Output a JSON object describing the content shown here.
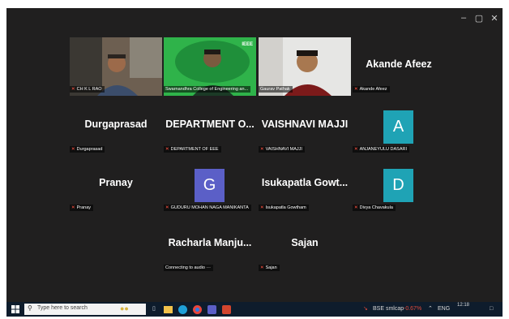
{
  "window_controls": {
    "minimize": "–",
    "maximize": "▢",
    "close": "✕"
  },
  "participants": [
    {
      "id": "chkl",
      "name": "",
      "label": "CH K L RAO",
      "type": "video"
    },
    {
      "id": "swarnandhra",
      "name": "",
      "label": "Swarnandhra College of Engineering an...",
      "type": "video",
      "brand": "IEEE"
    },
    {
      "id": "gaurav",
      "name": "",
      "label": "Gaurav Pathak",
      "type": "video"
    },
    {
      "id": "akande",
      "name": "Akande Afeez",
      "label": "Akande Afeez",
      "type": "name"
    },
    {
      "id": "durgaprasad",
      "name": "Durgaprasad",
      "label": "Durgaprasad",
      "type": "name"
    },
    {
      "id": "dept",
      "name": "DEPARTMENT O...",
      "label": "DEPARTMENT OF EEE",
      "type": "name"
    },
    {
      "id": "vaishnavi",
      "name": "VAISHNAVI MAJJI",
      "label": "VAISHNAVI MAJJI",
      "type": "name"
    },
    {
      "id": "anjaneyulu",
      "avatar": "A",
      "label": "ANJANEYULU DASARI",
      "type": "avatar",
      "color": "#1fa3b5"
    },
    {
      "id": "pranay",
      "name": "Pranay",
      "label": "Pranay",
      "type": "name"
    },
    {
      "id": "guduru",
      "avatar": "G",
      "label": "GUDURU MOHAN NAGA MANIKANTA",
      "type": "avatar",
      "color": "#5b5fc7"
    },
    {
      "id": "isukapatla",
      "name": "Isukapatla Gowt...",
      "label": "Isukapatla Gowtham",
      "type": "name"
    },
    {
      "id": "divya",
      "avatar": "D",
      "label": "Divya Chavakula",
      "type": "avatar",
      "color": "#1fa3b5"
    },
    {
      "id": "racharla",
      "name": "Racharla Manju...",
      "label": "Connecting to audio ···",
      "type": "connecting"
    },
    {
      "id": "sajan",
      "name": "Sajan",
      "label": "Sajan",
      "type": "name"
    }
  ],
  "mic_glyph": "⨯",
  "taskbar": {
    "search_placeholder": "Type here to search",
    "tray": {
      "app": "BSE smlcap",
      "change": "-0.67%",
      "lang": "ENG",
      "time": "12:18"
    }
  }
}
